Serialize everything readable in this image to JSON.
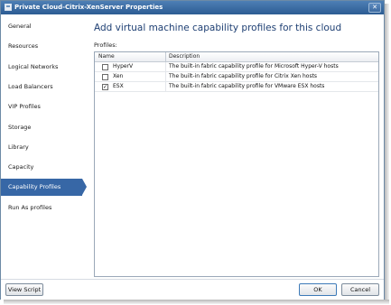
{
  "window": {
    "title": "Private Cloud-Citrix-XenServer Properties",
    "close_glyph": "✕"
  },
  "sidebar": {
    "items": [
      {
        "label": "General"
      },
      {
        "label": "Resources"
      },
      {
        "label": "Logical Networks"
      },
      {
        "label": "Load Balancers"
      },
      {
        "label": "VIP Profiles"
      },
      {
        "label": "Storage"
      },
      {
        "label": "Library"
      },
      {
        "label": "Capacity"
      },
      {
        "label": "Capability Profiles",
        "selected": true
      },
      {
        "label": "Run As profiles"
      }
    ]
  },
  "main": {
    "heading": "Add virtual machine capability profiles for this cloud",
    "profiles_label": "Profiles:",
    "columns": [
      "Name",
      "Description"
    ],
    "rows": [
      {
        "checked": false,
        "name": "HyperV",
        "description": "The built-in fabric capability profile for Microsoft Hyper-V hosts"
      },
      {
        "checked": false,
        "name": "Xen",
        "description": "The built-in fabric capability profile for Citrix Xen hosts"
      },
      {
        "checked": true,
        "name": "ESX",
        "description": "The built-in fabric capability profile for VMware ESX hosts"
      }
    ]
  },
  "footer": {
    "view_script": "View Script",
    "ok": "OK",
    "cancel": "Cancel"
  },
  "check_glyph": "✓",
  "colors": {
    "accent": "#3767a6",
    "titlebar": "#2c5c93",
    "heading": "#1e3f73"
  }
}
